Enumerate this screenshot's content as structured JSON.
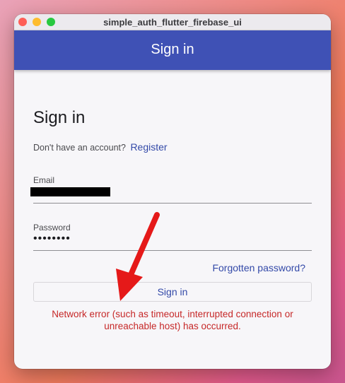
{
  "window": {
    "title": "simple_auth_flutter_firebase_ui"
  },
  "appbar": {
    "title": "Sign in"
  },
  "form": {
    "heading": "Sign in",
    "no_account_text": "Don't have an account?",
    "register_link": "Register",
    "email_label": "Email",
    "password_label": "Password",
    "password_value": "••••••••",
    "forgot_password": "Forgotten password?",
    "signin_button": "Sign in",
    "error_message": "Network error (such as timeout, interrupted connection or unreachable host) has occurred."
  },
  "colors": {
    "appbar": "#3f51b5",
    "link": "#3349a8",
    "error": "#c62828",
    "annotation_arrow": "#e51919"
  }
}
